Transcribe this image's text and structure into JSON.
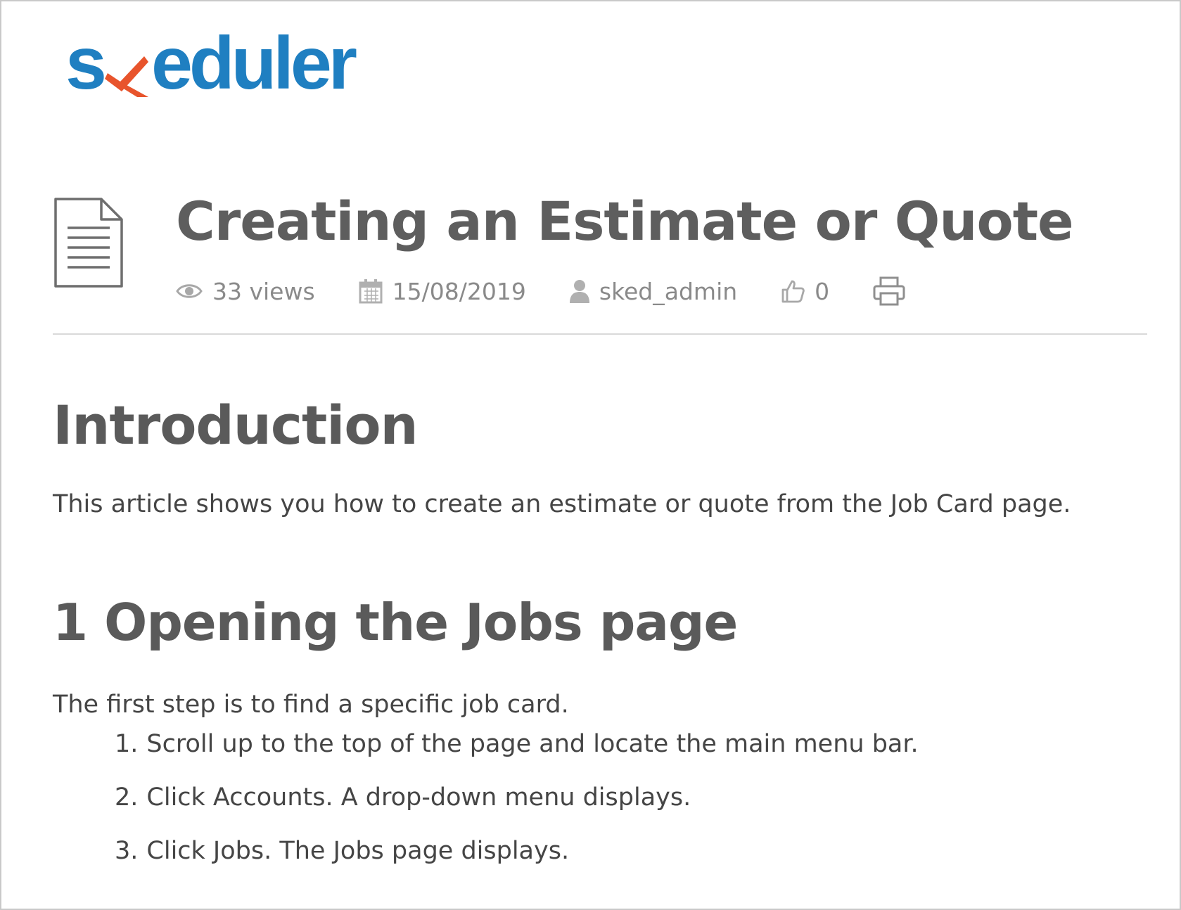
{
  "brand": {
    "logo_text_left": "s",
    "logo_text_right": "eduler",
    "logo_colors": {
      "blue": "#1f7fc1",
      "orange": "#e8542c"
    }
  },
  "article": {
    "title": "Creating an Estimate or Quote",
    "meta": {
      "views": "33 views",
      "date": "15/08/2019",
      "author": "sked_admin",
      "likes": "0"
    },
    "icons": {
      "document": "document-icon",
      "views": "eye-icon",
      "date": "calendar-icon",
      "author": "user-icon",
      "likes": "thumbs-up-icon",
      "print": "print-icon"
    }
  },
  "content": {
    "intro_heading": "Introduction",
    "intro_text": "This article shows you how to create an estimate or quote from the Job Card page.",
    "step1_heading": "1 Opening the Jobs page",
    "step1_text": "The first step is to find a specific job card.",
    "steps": [
      {
        "num": "1.",
        "text": "Scroll up to the top of the page and locate the main menu bar."
      },
      {
        "num": "2.",
        "text": "Click Accounts. A drop-down menu displays."
      },
      {
        "num": "3.",
        "text": "Click Jobs. The Jobs page displays."
      }
    ]
  }
}
